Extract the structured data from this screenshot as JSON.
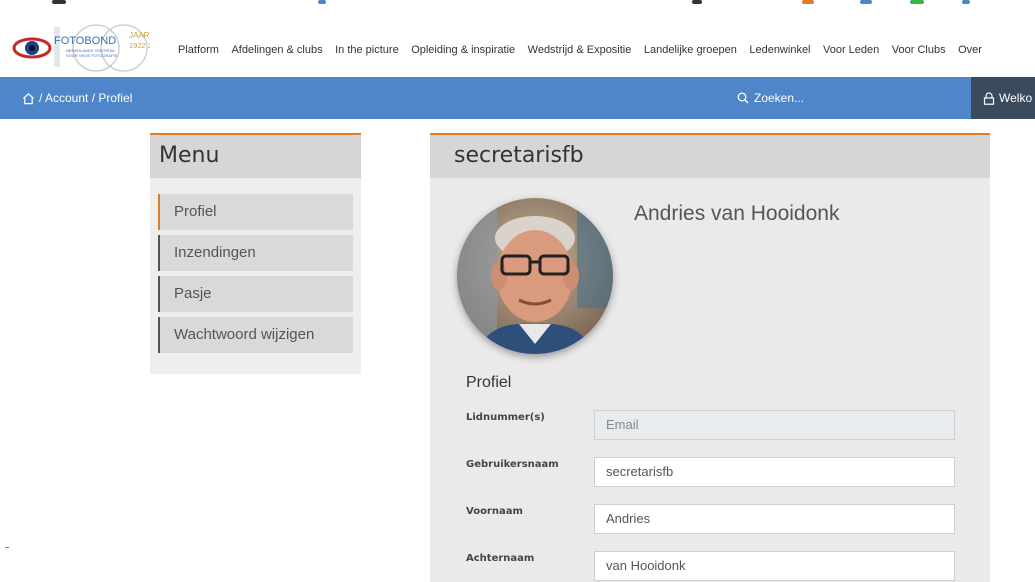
{
  "logo": {
    "brand": "FOTOBOND",
    "jaar": "JAAR",
    "years": "1922 2022",
    "subtitle1": "NEDERLANDS CENTRUM",
    "subtitle2": "VOOR VRIJE FOTOGRAFIE"
  },
  "nav": {
    "items": [
      "Platform",
      "Afdelingen & clubs",
      "In the picture",
      "Opleiding & inspiratie",
      "Wedstrijd & Expositie",
      "Landelijke groepen",
      "Ledenwinkel",
      "Voor Leden",
      "Voor Clubs",
      "Over"
    ]
  },
  "breadcrumb": {
    "text": "/ Account / Profiel",
    "icon": "home-icon"
  },
  "search": {
    "label": "Zoeken...",
    "icon": "search-icon"
  },
  "welcome": {
    "label": "Welko",
    "icon": "lock-icon"
  },
  "menu": {
    "title": "Menu",
    "items": [
      {
        "label": "Profiel",
        "active": true
      },
      {
        "label": "Inzendingen",
        "active": false
      },
      {
        "label": "Pasje",
        "active": false
      },
      {
        "label": "Wachtwoord wijzigen",
        "active": false
      }
    ]
  },
  "profile": {
    "username_heading": "secretarisfb",
    "full_name": "Andries van Hooidonk",
    "section_title": "Profiel",
    "fields": [
      {
        "label": "Lidnummer(s)",
        "value": "Email",
        "disabled": true
      },
      {
        "label": "Gebruikersnaam",
        "value": "secretarisfb",
        "disabled": false
      },
      {
        "label": "Voornaam",
        "value": "Andries",
        "disabled": false
      },
      {
        "label": "Achternaam",
        "value": "van Hooidonk",
        "disabled": false
      }
    ]
  },
  "colors": {
    "accent": "#e07b2a",
    "bar": "#4e86c9",
    "dark": "#3a4b5e"
  }
}
